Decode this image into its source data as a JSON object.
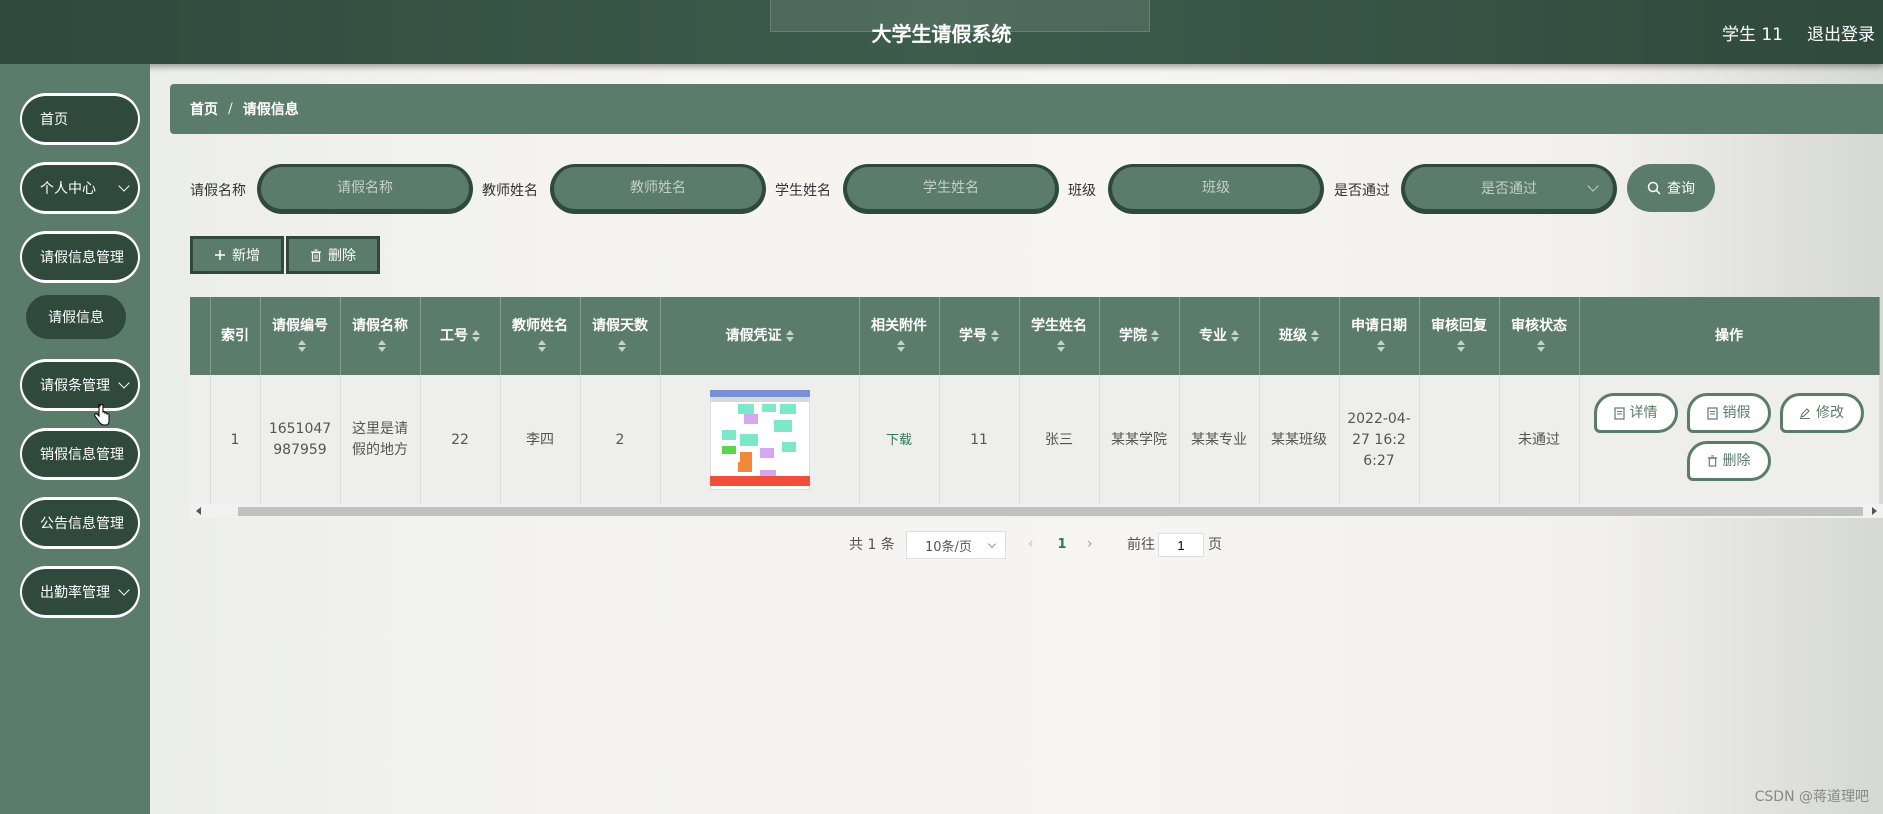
{
  "header": {
    "app_title": "大学生请假系统",
    "user_label": "学生 11",
    "logout_label": "退出登录"
  },
  "sidebar": {
    "items": [
      {
        "label": "首页"
      },
      {
        "label": "个人中心"
      },
      {
        "label": "请假信息管理"
      },
      {
        "label": "请假信息"
      },
      {
        "label": "请假条管理"
      },
      {
        "label": "销假信息管理"
      },
      {
        "label": "公告信息管理"
      },
      {
        "label": "出勤率管理"
      }
    ]
  },
  "breadcrumb": {
    "home": "首页",
    "separator": "/",
    "current": "请假信息"
  },
  "search": {
    "leave_name_label": "请假名称",
    "leave_name_placeholder": "请假名称",
    "teacher_label": "教师姓名",
    "teacher_placeholder": "教师姓名",
    "student_label": "学生姓名",
    "student_placeholder": "学生姓名",
    "class_label": "班级",
    "class_placeholder": "班级",
    "passed_label": "是否通过",
    "passed_placeholder": "是否通过",
    "query_label": "查询"
  },
  "actions": {
    "add_label": "新增",
    "delete_label": "删除"
  },
  "table": {
    "headers": {
      "index": "索引",
      "leave_no": "请假编号",
      "leave_name": "请假名称",
      "staff_no": "工号",
      "teacher_name": "教师姓名",
      "days": "请假天数",
      "voucher": "请假凭证",
      "attachment": "相关附件",
      "student_no": "学号",
      "student_name": "学生姓名",
      "college": "学院",
      "major": "专业",
      "class": "班级",
      "apply_date": "申请日期",
      "review_reply": "审核回复",
      "review_status": "审核状态",
      "ops": "操作"
    },
    "rows": [
      {
        "index": "1",
        "leave_no": "1651047987959",
        "leave_name": "这里是请假的地方",
        "staff_no": "22",
        "teacher_name": "李四",
        "days": "2",
        "attachment": "下载",
        "student_no": "11",
        "student_name": "张三",
        "college": "某某学院",
        "major": "某某专业",
        "class": "某某班级",
        "apply_date": "2022-04-27 16:26:27",
        "review_reply": "",
        "review_status": "未通过",
        "ops": {
          "detail": "详情",
          "cancel_leave": "销假",
          "edit": "修改",
          "delete": "删除"
        }
      }
    ]
  },
  "pagination": {
    "total_text": "共 1 条",
    "page_size": "10条/页",
    "current_page": "1",
    "goto_label": "前往",
    "goto_value": "1",
    "page_suffix": "页"
  },
  "watermark": "CSDN @蒋道理吧",
  "colors": {
    "primary": "#5b7b6b",
    "dark": "#2f4a3c",
    "link": "#2f7a5a"
  }
}
